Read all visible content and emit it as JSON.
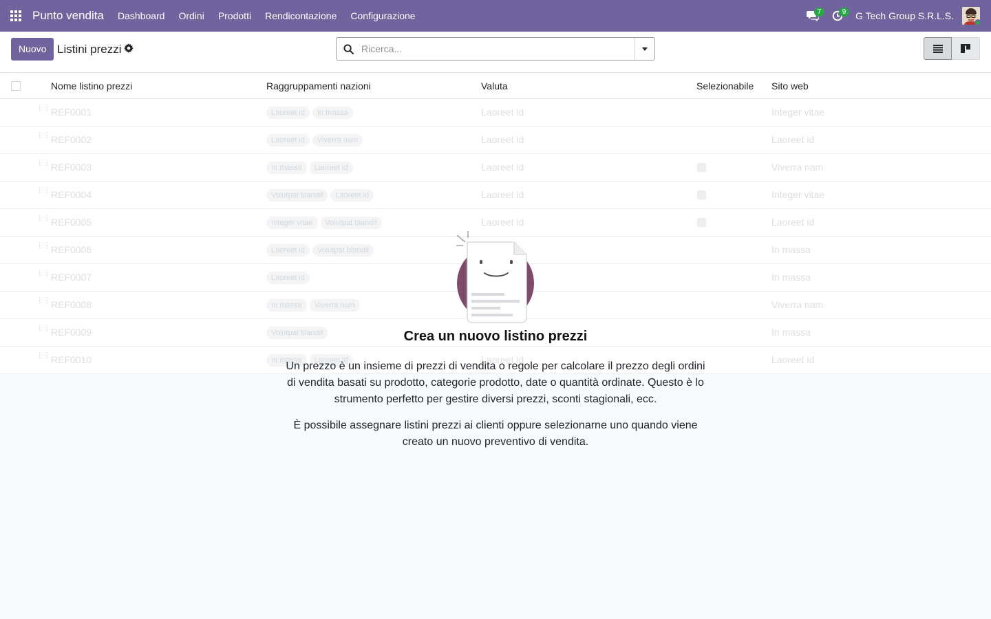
{
  "navbar": {
    "app_name": "Punto vendita",
    "menu": [
      "Dashboard",
      "Ordini",
      "Prodotti",
      "Rendicontazione",
      "Configurazione"
    ],
    "messages_badge": "7",
    "activities_badge": "9",
    "company": "G Tech Group S.R.L.S.",
    "accent_color": "#71639e"
  },
  "control_panel": {
    "new_button": "Nuovo",
    "title": "Listini prezzi",
    "search_placeholder": "Ricerca..."
  },
  "list": {
    "columns": [
      "Nome listino prezzi",
      "Raggruppamenti nazioni",
      "Valuta",
      "Selezionabile",
      "Sito web"
    ],
    "rows": [
      {
        "name": "REF0001",
        "tags": [
          "Laoreet id",
          "In massa"
        ],
        "currency": "Laoreet id",
        "selectable": false,
        "website": "Integer vitae"
      },
      {
        "name": "REF0002",
        "tags": [
          "Laoreet id",
          "Viverra nam"
        ],
        "currency": "Laoreet id",
        "selectable": false,
        "website": "Laoreet id"
      },
      {
        "name": "REF0003",
        "tags": [
          "In massa",
          "Laoreet id"
        ],
        "currency": "Laoreet id",
        "selectable": true,
        "website": "Viverra nam"
      },
      {
        "name": "REF0004",
        "tags": [
          "Volutpat blandit",
          "Laoreet id"
        ],
        "currency": "Laoreet id",
        "selectable": true,
        "website": "Integer vitae"
      },
      {
        "name": "REF0005",
        "tags": [
          "Integer vitae",
          "Volutpat blandit"
        ],
        "currency": "Laoreet id",
        "selectable": true,
        "website": "Laoreet id"
      },
      {
        "name": "REF0006",
        "tags": [
          "Laoreet id",
          "Volutpat blandit"
        ],
        "currency": "",
        "selectable": false,
        "website": "In massa"
      },
      {
        "name": "REF0007",
        "tags": [
          "Laoreet id"
        ],
        "currency": "",
        "selectable": false,
        "website": "In massa"
      },
      {
        "name": "REF0008",
        "tags": [
          "In massa",
          "Viverra nam"
        ],
        "currency": "",
        "selectable": false,
        "website": "Viverra nam"
      },
      {
        "name": "REF0009",
        "tags": [
          "Volutpat blandit"
        ],
        "currency": "",
        "selectable": false,
        "website": "In massa"
      },
      {
        "name": "REF0010",
        "tags": [
          "In massa",
          "Laoreet id"
        ],
        "currency": "Laoreet id",
        "selectable": false,
        "website": "Laoreet id"
      }
    ]
  },
  "helper": {
    "title": "Crea un nuovo listino prezzi",
    "paragraph1": "Un prezzo è un insieme di prezzi di vendita o regole per calcolare il prezzo degli ordini di vendita basati su prodotto, categorie prodotto, date o quantità ordinate. Questo è lo strumento perfetto per gestire diversi prezzi, sconti stagionali, ecc.",
    "paragraph2": "È possibile assegnare listini prezzi ai clienti oppure selezionarne uno quando viene creato un nuovo preventivo di vendita."
  }
}
